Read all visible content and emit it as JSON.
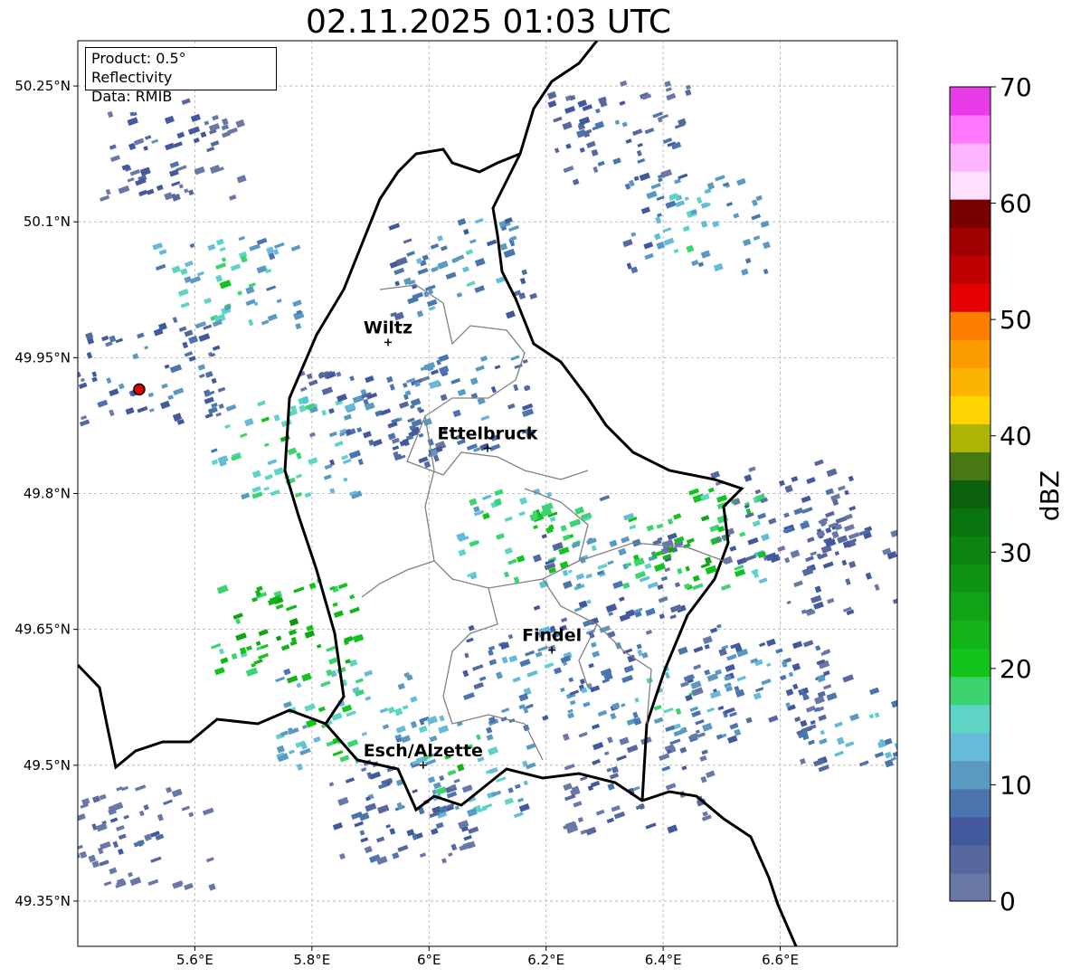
{
  "title": "02.11.2025 01:03 UTC",
  "info": {
    "product": "Product: 0.5° Reflectivity",
    "source": "Data: RMIB"
  },
  "map": {
    "lon_range": [
      5.4,
      6.8
    ],
    "lat_range": [
      49.3,
      50.3
    ],
    "x_ticks": [
      {
        "value": 5.6,
        "label": "5.6°E"
      },
      {
        "value": 5.8,
        "label": "5.8°E"
      },
      {
        "value": 6.0,
        "label": "6°E"
      },
      {
        "value": 6.2,
        "label": "6.2°E"
      },
      {
        "value": 6.4,
        "label": "6.4°E"
      },
      {
        "value": 6.6,
        "label": "6.6°E"
      }
    ],
    "y_ticks": [
      {
        "value": 50.25,
        "label": "50.25°N"
      },
      {
        "value": 50.1,
        "label": "50.1°N"
      },
      {
        "value": 49.95,
        "label": "49.95°N"
      },
      {
        "value": 49.8,
        "label": "49.8°N"
      },
      {
        "value": 49.65,
        "label": "49.65°N"
      },
      {
        "value": 49.5,
        "label": "49.5°N"
      },
      {
        "value": 49.35,
        "label": "49.35°N"
      }
    ],
    "grid": true,
    "radar_site": {
      "lon": 5.505,
      "lat": 49.915
    },
    "cities": [
      {
        "name": "Wiltz",
        "lon": 5.93,
        "lat": 49.967
      },
      {
        "name": "Ettelbruck",
        "lon": 6.1,
        "lat": 49.85
      },
      {
        "name": "Findel",
        "lon": 6.21,
        "lat": 49.627
      },
      {
        "name": "Esch/Alzette",
        "lon": 5.99,
        "lat": 49.5
      }
    ],
    "echo_regions": [
      {
        "lon": 5.55,
        "lat": 50.18,
        "intensity": 8
      },
      {
        "lon": 5.65,
        "lat": 50.03,
        "intensity": 18
      },
      {
        "lon": 5.52,
        "lat": 49.93,
        "intensity": 12
      },
      {
        "lon": 5.75,
        "lat": 49.85,
        "intensity": 20
      },
      {
        "lon": 5.9,
        "lat": 49.88,
        "intensity": 10
      },
      {
        "lon": 6.05,
        "lat": 49.9,
        "intensity": 14
      },
      {
        "lon": 6.17,
        "lat": 49.75,
        "intensity": 22
      },
      {
        "lon": 6.3,
        "lat": 49.7,
        "intensity": 12
      },
      {
        "lon": 6.45,
        "lat": 49.75,
        "intensity": 24
      },
      {
        "lon": 6.6,
        "lat": 49.78,
        "intensity": 10
      },
      {
        "lon": 6.72,
        "lat": 49.72,
        "intensity": 8
      },
      {
        "lon": 5.75,
        "lat": 49.65,
        "intensity": 26
      },
      {
        "lon": 5.85,
        "lat": 49.55,
        "intensity": 20
      },
      {
        "lon": 6.05,
        "lat": 49.5,
        "intensity": 18
      },
      {
        "lon": 6.18,
        "lat": 49.6,
        "intensity": 14
      },
      {
        "lon": 6.4,
        "lat": 49.58,
        "intensity": 16
      },
      {
        "lon": 6.55,
        "lat": 49.6,
        "intensity": 12
      },
      {
        "lon": 6.75,
        "lat": 49.55,
        "intensity": 14
      },
      {
        "lon": 5.5,
        "lat": 49.42,
        "intensity": 6
      },
      {
        "lon": 5.95,
        "lat": 49.45,
        "intensity": 10
      },
      {
        "lon": 6.35,
        "lat": 49.48,
        "intensity": 8
      },
      {
        "lon": 6.45,
        "lat": 50.1,
        "intensity": 16
      },
      {
        "lon": 6.32,
        "lat": 50.2,
        "intensity": 10
      },
      {
        "lon": 6.05,
        "lat": 50.05,
        "intensity": 14
      }
    ]
  },
  "colorbar": {
    "label": "dBZ",
    "min": 0,
    "max": 70,
    "ticks": [
      0,
      10,
      20,
      30,
      40,
      50,
      60,
      70
    ],
    "colors": [
      "#6a78a8",
      "#56689e",
      "#43599e",
      "#4b75ae",
      "#5a9ac2",
      "#66bcd8",
      "#5ed4c4",
      "#3cd470",
      "#12c41c",
      "#12b41a",
      "#10a416",
      "#0e9412",
      "#0c8410",
      "#0a740e",
      "#0a600c",
      "#487814",
      "#acb404",
      "#ffd400",
      "#fcb400",
      "#fc9c00",
      "#fc8000",
      "#e40000",
      "#c00000",
      "#a00000",
      "#780000",
      "#ffe0ff",
      "#ffb4ff",
      "#ff78ff",
      "#e83ce8"
    ]
  }
}
